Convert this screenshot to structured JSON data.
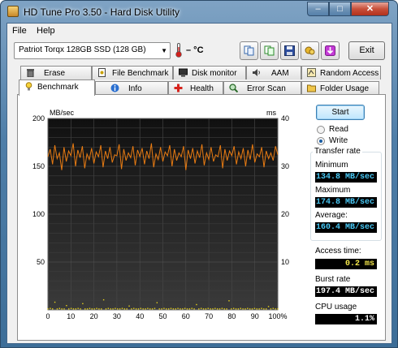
{
  "window": {
    "title": "HD Tune Pro 3.50 - Hard Disk Utility",
    "min": "–",
    "max": "□",
    "close": "✕"
  },
  "menu": {
    "file": "File",
    "help": "Help"
  },
  "drive": {
    "selected": "Patriot Torqx 128GB SSD (128 GB)",
    "temperature": "– °C"
  },
  "toolbar": {
    "icons": [
      "copy-icon",
      "copy-info-icon",
      "save-icon",
      "options-icon",
      "download-icon"
    ],
    "exit_label": "Exit"
  },
  "tabs_back": [
    {
      "label": "Erase",
      "icon": "trash-icon"
    },
    {
      "label": "File Benchmark",
      "icon": "file-icon"
    },
    {
      "label": "Disk monitor",
      "icon": "monitor-icon"
    },
    {
      "label": "AAM",
      "icon": "speaker-icon"
    },
    {
      "label": "Random Access",
      "icon": "random-access-icon"
    }
  ],
  "tabs_front": [
    {
      "label": "Benchmark",
      "icon": "lightbulb-icon",
      "active": true
    },
    {
      "label": "Info",
      "icon": "info-icon",
      "active": false
    },
    {
      "label": "Health",
      "icon": "health-cross-icon",
      "active": false
    },
    {
      "label": "Error Scan",
      "icon": "magnifier-icon",
      "active": false
    },
    {
      "label": "Folder Usage",
      "icon": "folder-icon",
      "active": false
    }
  ],
  "controls": {
    "start_label": "Start",
    "read_label": "Read",
    "write_label": "Write",
    "mode": "Write"
  },
  "transfer_rate": {
    "title": "Transfer rate",
    "minimum_label": "Minimum",
    "minimum_value": "134.8 MB/sec",
    "maximum_label": "Maximum",
    "maximum_value": "174.8 MB/sec",
    "average_label": "Average:",
    "average_value": "160.4 MB/sec"
  },
  "access_time": {
    "label": "Access time:",
    "value": "0.2 ms"
  },
  "burst_rate": {
    "label": "Burst rate",
    "value": "197.4 MB/sec"
  },
  "cpu_usage": {
    "label": "CPU usage",
    "value": "1.1%"
  },
  "colors": {
    "transfer_line": "#e87b12",
    "access_dots": "#e8d21a",
    "lcd_blue": "#49c8f5",
    "lcd_yellow": "#f5e84b"
  },
  "chart_data": {
    "type": "line",
    "ylabel_left": "MB/sec",
    "ylabel_right": "ms",
    "ylim_left": [
      0,
      200
    ],
    "ylim_right": [
      0,
      40
    ],
    "yticks_left": [
      "200",
      "150",
      "100",
      "50"
    ],
    "yticks_right": [
      "40",
      "30",
      "20",
      "10"
    ],
    "xticks": [
      "0",
      "10",
      "20",
      "30",
      "40",
      "50",
      "60",
      "70",
      "80",
      "90",
      "100%"
    ],
    "xlim": [
      0,
      100
    ],
    "grid": true,
    "series": [
      {
        "values": [
          160,
          168,
          152,
          172,
          158,
          164,
          146,
          170,
          155,
          166,
          161,
          174,
          150,
          167,
          159,
          171,
          148,
          163,
          157,
          169,
          153,
          165,
          160,
          172,
          149,
          166,
          158,
          170,
          154,
          162,
          161,
          173,
          147,
          168,
          156,
          164,
          159,
          171,
          151,
          167,
          160,
          169,
          152,
          166,
          158,
          174,
          149,
          163,
          157,
          170,
          155,
          165,
          161,
          172,
          150,
          168,
          156,
          164,
          160,
          171,
          146,
          167,
          158,
          169,
          153,
          166,
          159,
          173,
          151,
          164,
          157,
          170,
          155,
          162,
          160,
          172,
          148,
          168,
          156,
          166,
          161,
          171,
          152,
          165,
          158,
          169,
          150,
          167,
          157,
          173,
          154,
          163,
          160,
          170,
          149,
          166,
          158,
          164,
          156,
          171,
          162
        ]
      }
    ],
    "access_time_points_ms": [
      0.2,
      0.3,
      0.2,
      1.6,
      0.2,
      0.3,
      0.2,
      0.2,
      0.9,
      0.2,
      0.3,
      0.2,
      0.2,
      0.3,
      0.2,
      1.3,
      0.2,
      0.2,
      0.3,
      0.2,
      0.2,
      0.3,
      0.2,
      0.2,
      2.1,
      0.2,
      0.3,
      0.2,
      0.2,
      0.3,
      0.2,
      0.2,
      0.3,
      0.2,
      0.2,
      0.8,
      0.2,
      0.3,
      0.2,
      0.2,
      0.3,
      0.2,
      0.2,
      0.3,
      0.2,
      0.2,
      0.3,
      1.5,
      0.2,
      0.2,
      0.3,
      0.2,
      0.2,
      0.3,
      0.2,
      0.2,
      0.3,
      0.2,
      0.2,
      0.3,
      0.2,
      0.2,
      0.3,
      0.2,
      1.1,
      0.2,
      0.3,
      0.2,
      0.2,
      0.3,
      0.2,
      0.2,
      0.3,
      0.2,
      0.2,
      0.3,
      0.2,
      0.2,
      1.9,
      0.2,
      0.3,
      0.2,
      0.2,
      0.3,
      0.2,
      0.2,
      0.3,
      0.2,
      0.2,
      0.3,
      0.2,
      0.2,
      0.3,
      0.2,
      0.2,
      0.7,
      0.2,
      0.3,
      0.2,
      0.2
    ]
  }
}
